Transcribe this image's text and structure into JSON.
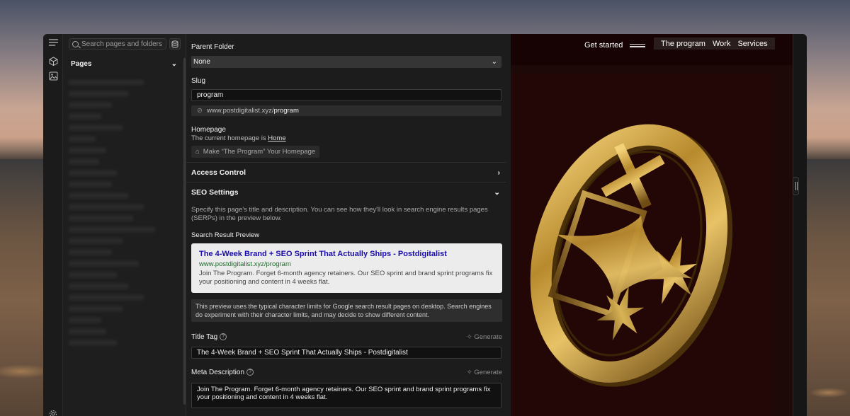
{
  "sidebar": {
    "search_placeholder": "Search pages and folders",
    "pages_heading": "Pages"
  },
  "settings": {
    "parent_folder": {
      "label": "Parent Folder",
      "value": "None"
    },
    "slug": {
      "label": "Slug",
      "value": "program",
      "url_prefix": "www.postdigitalist.xyz/",
      "url_slug": "program"
    },
    "homepage": {
      "label": "Homepage",
      "text": "The current homepage is",
      "link": "Home",
      "button": "Make “The Program” Your Homepage"
    },
    "access_control": "Access Control",
    "seo": {
      "heading": "SEO Settings",
      "description": "Specify this page's title and description. You can see how they'll look in search engine results pages (SERPs) in the preview below.",
      "preview_label": "Search Result Preview",
      "preview_title": "The 4-Week Brand + SEO Sprint That Actually Ships - Postdigitalist",
      "preview_url": "www.postdigitalist.xyz/program",
      "preview_desc": "Join The Program. Forget 6-month agency retainers. Our SEO sprint and brand sprint programs fix your positioning and content in 4 weeks flat.",
      "note": "This preview uses the typical character limits for Google search result pages on desktop. Search engines do experiment with their character limits, and may decide to show different content.",
      "title_tag_label": "Title Tag",
      "title_tag_value": "The 4-Week Brand + SEO Sprint That Actually Ships - Postdigitalist",
      "meta_label": "Meta Description",
      "meta_value": "Join The Program. Forget 6-month agency retainers. Our SEO sprint and brand sprint programs fix your positioning and content in 4 weeks flat.",
      "generate": "Generate"
    }
  },
  "preview": {
    "get_started": "Get started",
    "nav": [
      "The program",
      "Work",
      "Services"
    ]
  },
  "colors": {
    "preview_bg": "#1e0909",
    "gold": "#c9a24a",
    "serp_link": "#1a0dab",
    "serp_url": "#1d6b2a"
  }
}
